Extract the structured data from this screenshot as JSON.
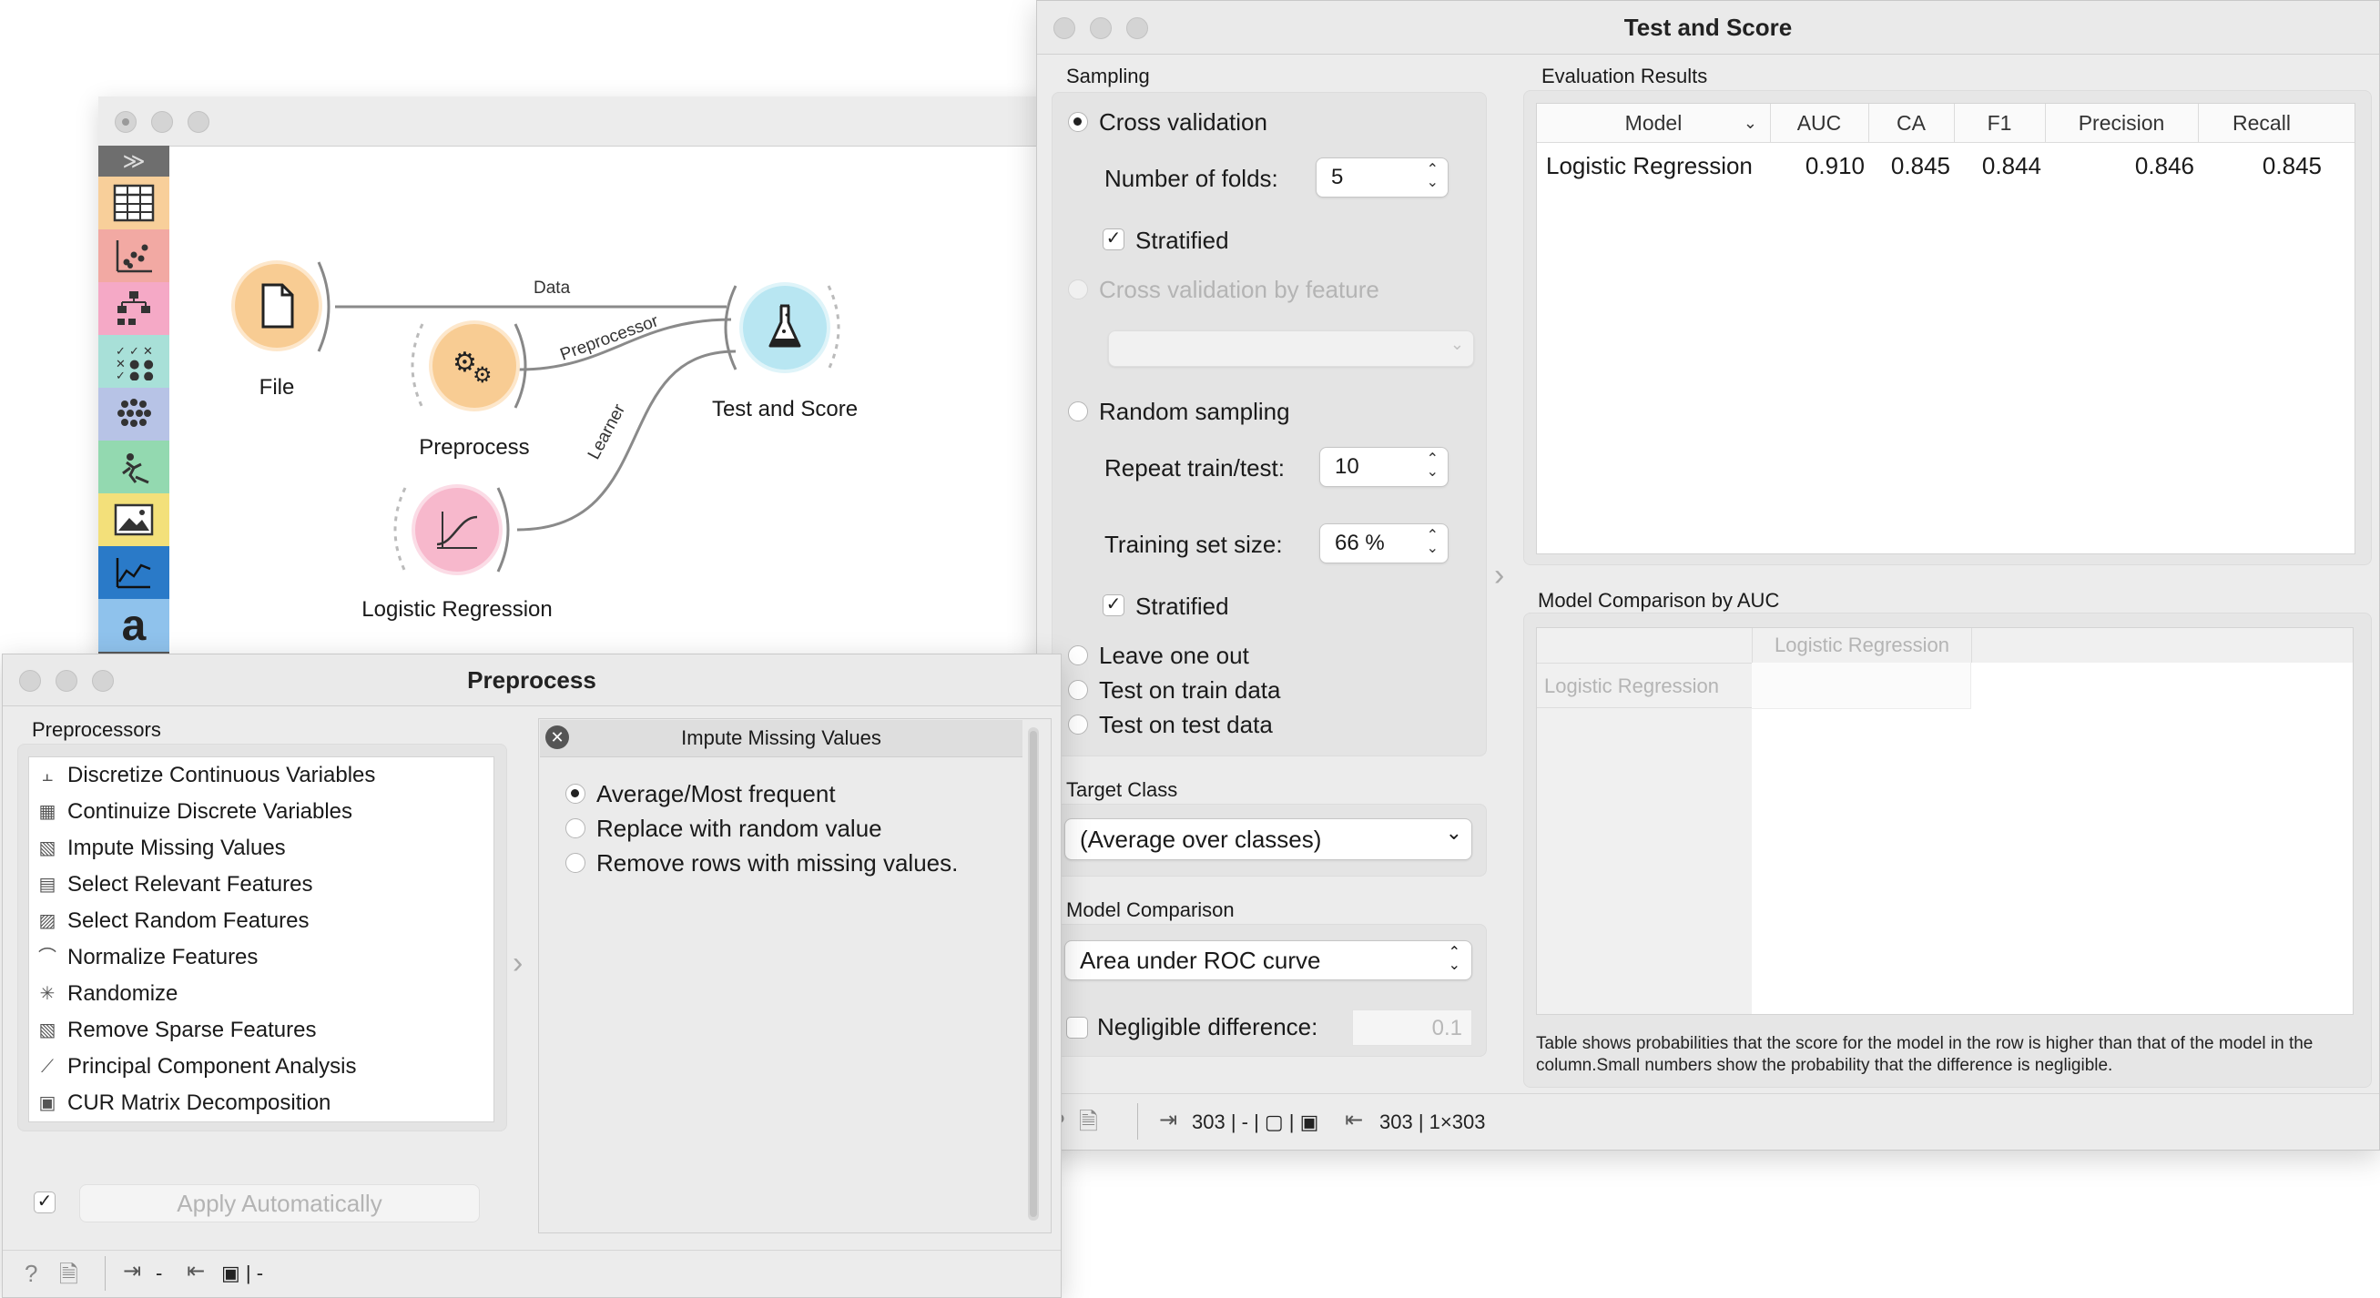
{
  "canvas": {
    "sidebar_icons": [
      "expand-icon",
      "data-table-icon",
      "scatter-icon",
      "tree-icon",
      "checklist-icon",
      "cluster-icon",
      "explore-icon",
      "image-icon",
      "line-chart-icon",
      "text-icon"
    ],
    "nodes": [
      {
        "label": "File",
        "color": "#f7c98f",
        "icon": "file-icon"
      },
      {
        "label": "Preprocess",
        "color": "#f7c98f",
        "icon": "gears-icon"
      },
      {
        "label": "Test and Score",
        "color": "#b3e6f2",
        "icon": "flask-icon"
      },
      {
        "label": "Logistic Regression",
        "color": "#f7b8cc",
        "icon": "sigmoid-icon"
      }
    ],
    "links": [
      "Data",
      "Preprocessor",
      "Learner"
    ]
  },
  "tas": {
    "title": "Test and Score",
    "sampling": {
      "header": "Sampling",
      "cross_validation": "Cross validation",
      "folds_label": "Number of folds:",
      "folds_value": "5",
      "stratified": "Stratified",
      "cv_by_feature": "Cross validation by feature",
      "random_sampling": "Random sampling",
      "repeat_label": "Repeat train/test:",
      "repeat_value": "10",
      "train_size_label": "Training set size:",
      "train_size_value": "66 %",
      "stratified2": "Stratified",
      "leave_one_out": "Leave one out",
      "test_train": "Test on train data",
      "test_test": "Test on test data"
    },
    "target": {
      "header": "Target Class",
      "value": "(Average over classes)"
    },
    "comparison": {
      "header": "Model Comparison",
      "value": "Area under ROC curve",
      "negligible_label": "Negligible difference:",
      "negligible_value": "0.1"
    },
    "results": {
      "header": "Evaluation Results",
      "columns": [
        "Model",
        "AUC",
        "CA",
        "F1",
        "Precision",
        "Recall"
      ],
      "rows": [
        [
          "Logistic Regression",
          "0.910",
          "0.845",
          "0.844",
          "0.846",
          "0.845"
        ]
      ]
    },
    "auc": {
      "header": "Model Comparison by AUC",
      "col": "Logistic Regression",
      "row": "Logistic Regression",
      "note": "Table shows probabilities that the score for the model in the row is higher than that of the model in the column.Small numbers show the probability that the difference is negligible."
    },
    "status": {
      "input": "303 | - | ▢ | ▣",
      "output": "303 | 1×303"
    }
  },
  "pre": {
    "title": "Preprocess",
    "header": "Preprocessors",
    "items": [
      "Discretize Continuous Variables",
      "Continuize Discrete Variables",
      "Impute Missing Values",
      "Select Relevant Features",
      "Select Random Features",
      "Normalize Features",
      "Randomize",
      "Remove Sparse Features",
      "Principal Component Analysis",
      "CUR Matrix Decomposition"
    ],
    "panel": {
      "title": "Impute Missing Values",
      "options": [
        "Average/Most frequent",
        "Replace with random value",
        "Remove rows with missing values."
      ]
    },
    "apply": "Apply Automatically",
    "status": {
      "input": "-",
      "output": "▣ | -"
    }
  }
}
